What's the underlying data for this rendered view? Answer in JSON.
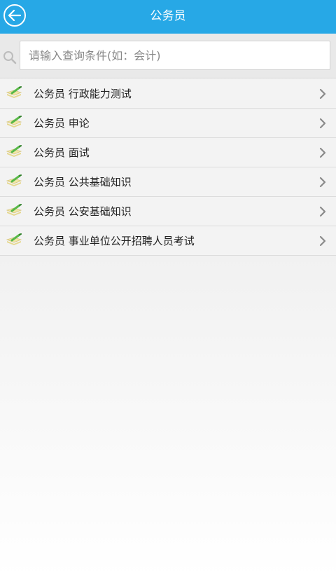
{
  "header": {
    "title": "公务员",
    "back_icon": "back-arrow-icon"
  },
  "search": {
    "placeholder": "请输入查询条件(如：会计)",
    "icon": "search-icon"
  },
  "list": {
    "items": [
      {
        "label": "公务员 行政能力测试",
        "icon": "book-pencil-icon"
      },
      {
        "label": "公务员 申论",
        "icon": "book-pencil-icon"
      },
      {
        "label": "公务员 面试",
        "icon": "book-pencil-icon"
      },
      {
        "label": "公务员 公共基础知识",
        "icon": "book-pencil-icon"
      },
      {
        "label": "公务员 公安基础知识",
        "icon": "book-pencil-icon"
      },
      {
        "label": "公务员 事业单位公开招聘人员考试",
        "icon": "book-pencil-icon"
      }
    ]
  },
  "colors": {
    "header_bg": "#27a8e6",
    "list_bg": "#f3f3f3",
    "divider": "#dcdcdc"
  }
}
